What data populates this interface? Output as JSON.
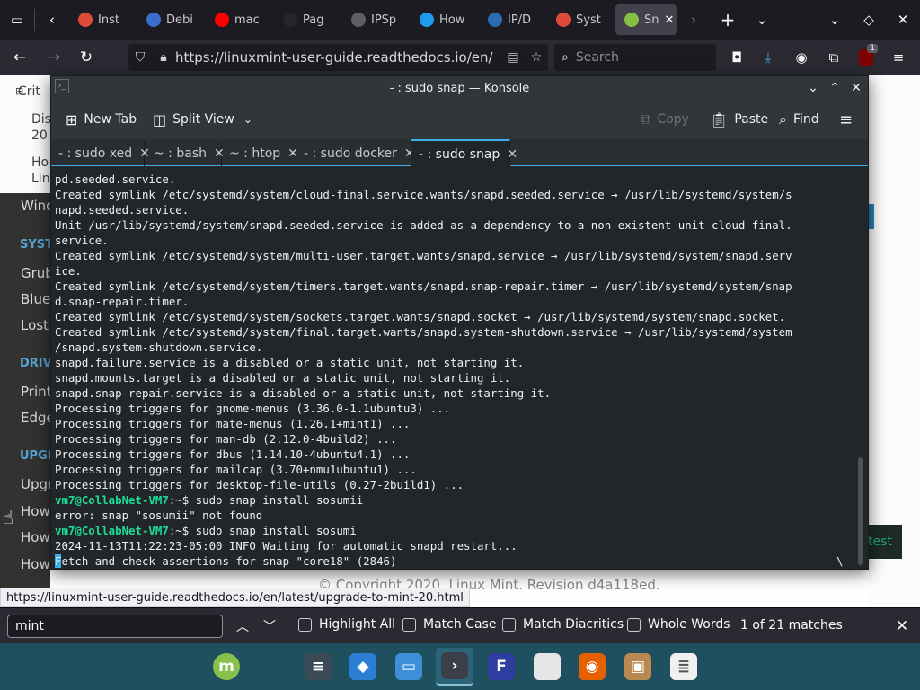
{
  "firefox": {
    "tabs": [
      {
        "label": "Inst",
        "favicon_color": "#dd4b39"
      },
      {
        "label": "Debi",
        "favicon_color": "#3b6fc9"
      },
      {
        "label": "mac",
        "favicon_color": "#ff0000"
      },
      {
        "label": "Pag",
        "favicon_color": "#26252b"
      },
      {
        "label": "IPSp",
        "favicon_color": "#5e5e66"
      },
      {
        "label": "How",
        "favicon_color": "#1d9bf0"
      },
      {
        "label": "IP/D",
        "favicon_color": "#2b6cb0"
      },
      {
        "label": "Syst",
        "favicon_color": "#e04a3b"
      },
      {
        "label": "Sn",
        "favicon_color": "#86be43"
      }
    ],
    "url": "https://linuxmint-user-guide.readthedocs.io/en/",
    "search_placeholder": "Search",
    "extension_badge": "1"
  },
  "webpage": {
    "sidebar_top": [
      "Crit",
      "Dis",
      "20",
      "Ho",
      "Lin"
    ],
    "sidebar": {
      "window_item": "Wind",
      "cap_system": "SYST",
      "system_items": [
        "Grub",
        "Bluet",
        "Lost"
      ],
      "cap_drivers": "DRIV",
      "driver_items": [
        "Printe",
        "Edge"
      ],
      "cap_upgrade": "UPGR",
      "upgrade_items": [
        "Upgr",
        "How",
        "How",
        "How"
      ]
    },
    "test_button": "test",
    "footer": "© Copyright 2020, Linux Mint. Revision d4a118ed."
  },
  "konsole": {
    "title": "- : sudo snap — Konsole",
    "toolbar": {
      "new_tab": "New Tab",
      "split_view": "Split View",
      "copy": "Copy",
      "paste": "Paste",
      "find": "Find"
    },
    "tabs": [
      {
        "label": "- : sudo xed"
      },
      {
        "label": "~ : bash"
      },
      {
        "label": "~ : htop"
      },
      {
        "label": "- : sudo docker"
      },
      {
        "label": "- : sudo snap"
      }
    ],
    "prompt_user": "vm7@CollabNet-VM7",
    "prompt_path": ":~$",
    "lines": [
      "pd.seeded.service.",
      "Created symlink /etc/systemd/system/cloud-final.service.wants/snapd.seeded.service → /usr/lib/systemd/system/s",
      "napd.seeded.service.",
      "Unit /usr/lib/systemd/system/snapd.seeded.service is added as a dependency to a non-existent unit cloud-final.",
      "service.",
      "Created symlink /etc/systemd/system/multi-user.target.wants/snapd.service → /usr/lib/systemd/system/snapd.serv",
      "ice.",
      "Created symlink /etc/systemd/system/timers.target.wants/snapd.snap-repair.timer → /usr/lib/systemd/system/snap",
      "d.snap-repair.timer.",
      "Created symlink /etc/systemd/system/sockets.target.wants/snapd.socket → /usr/lib/systemd/system/snapd.socket.",
      "Created symlink /etc/systemd/system/final.target.wants/snapd.system-shutdown.service → /usr/lib/systemd/system",
      "/snapd.system-shutdown.service.",
      "snapd.failure.service is a disabled or a static unit, not starting it.",
      "snapd.mounts.target is a disabled or a static unit, not starting it.",
      "snapd.snap-repair.service is a disabled or a static unit, not starting it.",
      "Processing triggers for gnome-menus (3.36.0-1.1ubuntu3) ...",
      "Processing triggers for mate-menus (1.26.1+mint1) ...",
      "Processing triggers for man-db (2.12.0-4build2) ...",
      "Processing triggers for dbus (1.14.10-4ubuntu4.1) ...",
      "Processing triggers for mailcap (3.70+nmu1ubuntu1) ...",
      "Processing triggers for desktop-file-utils (0.27-2build1) ..."
    ],
    "cmd1": " sudo snap install sosumii",
    "err1": "error: snap \"sosumii\" not found",
    "cmd2": " sudo snap install sosumi",
    "info_line": "2024-11-13T11:22:23-05:00 INFO Waiting for automatic snapd restart...",
    "last_line": "etch and check assertions for snap \"core18\" (2846)",
    "last_line_cursor_char": "F",
    "spinner": "\\"
  },
  "status_link": "https://linuxmint-user-guide.readthedocs.io/en/latest/upgrade-to-mint-20.html",
  "findbar": {
    "query": "mint",
    "highlight_all": "Highlight All",
    "match_case": "Match Case",
    "match_diacritics": "Match Diacritics",
    "whole_words": "Whole Words",
    "count": "1 of 21 matches"
  },
  "taskbar": {
    "apps": [
      {
        "name": "mint-menu",
        "color": "#87c04a",
        "glyph": "m"
      },
      {
        "name": "settings",
        "color": "#3c4a55",
        "glyph": "≡"
      },
      {
        "name": "software",
        "color": "#2a7fd4",
        "glyph": "◆"
      },
      {
        "name": "files",
        "color": "#3e8fd8",
        "glyph": "▭"
      },
      {
        "name": "terminal",
        "color": "#3b4048",
        "glyph": "›"
      },
      {
        "name": "app-f",
        "color": "#2e3ea0",
        "glyph": "F"
      },
      {
        "name": "text-editor",
        "color": "#e6e6e6",
        "glyph": ""
      },
      {
        "name": "firefox",
        "color": "#e66000",
        "glyph": "◉"
      },
      {
        "name": "archive",
        "color": "#b88a52",
        "glyph": "▣"
      },
      {
        "name": "document",
        "color": "#f0f0f0",
        "glyph": "≣"
      }
    ]
  }
}
